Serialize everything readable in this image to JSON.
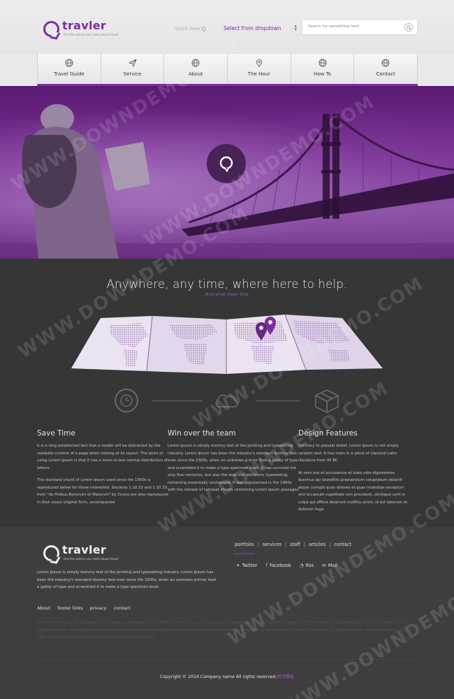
{
  "header": {
    "logo": "travler",
    "tagline": "Get the advice you need about travel",
    "quick_links": "Quick links",
    "dropdown": "Select from dropdown",
    "search_placeholder": "Search for something here"
  },
  "nav": {
    "items": [
      {
        "label": "Travel Guide",
        "icon": "globe-icon"
      },
      {
        "label": "Service",
        "icon": "paper-plane-icon"
      },
      {
        "label": "About",
        "icon": "globe-icon"
      },
      {
        "label": "The Hour",
        "icon": "map-pin-icon"
      },
      {
        "label": "How To",
        "icon": "globe-icon"
      },
      {
        "label": "Contact",
        "icon": "globe-icon"
      }
    ]
  },
  "hero": {
    "icon": "chat-bubble-icon"
  },
  "main": {
    "headline": "Anywhere, any time, where here to help.",
    "subline": "And what mean that",
    "columns": [
      {
        "title": "Save Time",
        "paragraphs": [
          "It is a long established fact that a reader will be distracted by the readable content of a page when looking at its layout. The point of using Lorem Ipsum is that it has a more-or-less normal distribution of letters.",
          "The standard chunk of Lorem Ipsum used since the 1500s is reproduced below for those interested. Sections 1.10.32 and 1.10.33 from \"de Finibus Bonorum et Malorum\" by Cicero are also reproduced in their exact original form, accompanied"
        ]
      },
      {
        "title": "Win over the team",
        "paragraphs": [
          "Lorem Ipsum is simply dummy text of the printing and typesetting industry. Lorem Ipsum has been the industry's standard dummy text ever since the 1500s, when an unknown printer took a galley of type and scrambled it to make a type specimen book. It has survived not only five centuries, but also the leap into electronic typesetting, remaining essentially unchanged. It was popularised in the 1960s with the release of Letraset sheets containing Lorem Ipsum passages."
        ]
      },
      {
        "title": "Design Features",
        "paragraphs": [
          "Contrary to popular belief, Lorem Ipsum is not simply random text. It has roots in a piece of classical Latin literature from 45 BC",
          "At vero eos et accusamus et iusto odio dignissimos ducimus qui blanditiis praesentium voluptatum deleniti atque corrupti quos dolores et quas molestias excepturi sint occaecati cupiditate non provident, similique sunt in culpa qui officia deserunt mollitia animi, id est laborum et dolorum fuga."
        ]
      }
    ]
  },
  "footer": {
    "logo": "travler",
    "tagline": "Get the advice you need about travel",
    "about": "Lorem Ipsum is simply dummy text of the printing and typesetting industry. Lorem Ipsum has been the industry's standard dummy text ever since the 1500s, when an unknown printer took a galley of type and scrambled it to make a type specimen book.",
    "menu": [
      "portfolio",
      "services",
      "staff",
      "articles",
      "contact"
    ],
    "social": [
      "Twitter",
      "Facebook",
      "Rss",
      "Mail"
    ],
    "links": [
      "About",
      "footer links",
      "privacy",
      "contact"
    ],
    "faint_text": "On the other hand, we denounce with righteous indignation and dislike men who are so beguiled and demoralized by the charms of pleasure of the moment, so blinded by desire, that they cannot foresee the pain and trouble that are bound to ensue; and equal blame belongs to those who fail in their duty through weakness of will, which is the same as saying through shrinking from toil and pain. These cases are perfectly simple and easy to distinguish.",
    "copyright": "Copyright © 2014.Company name All rights reserved.",
    "copyright_cn": "网页模板"
  },
  "watermark": "WWW.DOWNDEMO.COM",
  "colors": {
    "accent": "#7b2d9e",
    "dark": "#363636",
    "footer": "#3e3e3e"
  }
}
